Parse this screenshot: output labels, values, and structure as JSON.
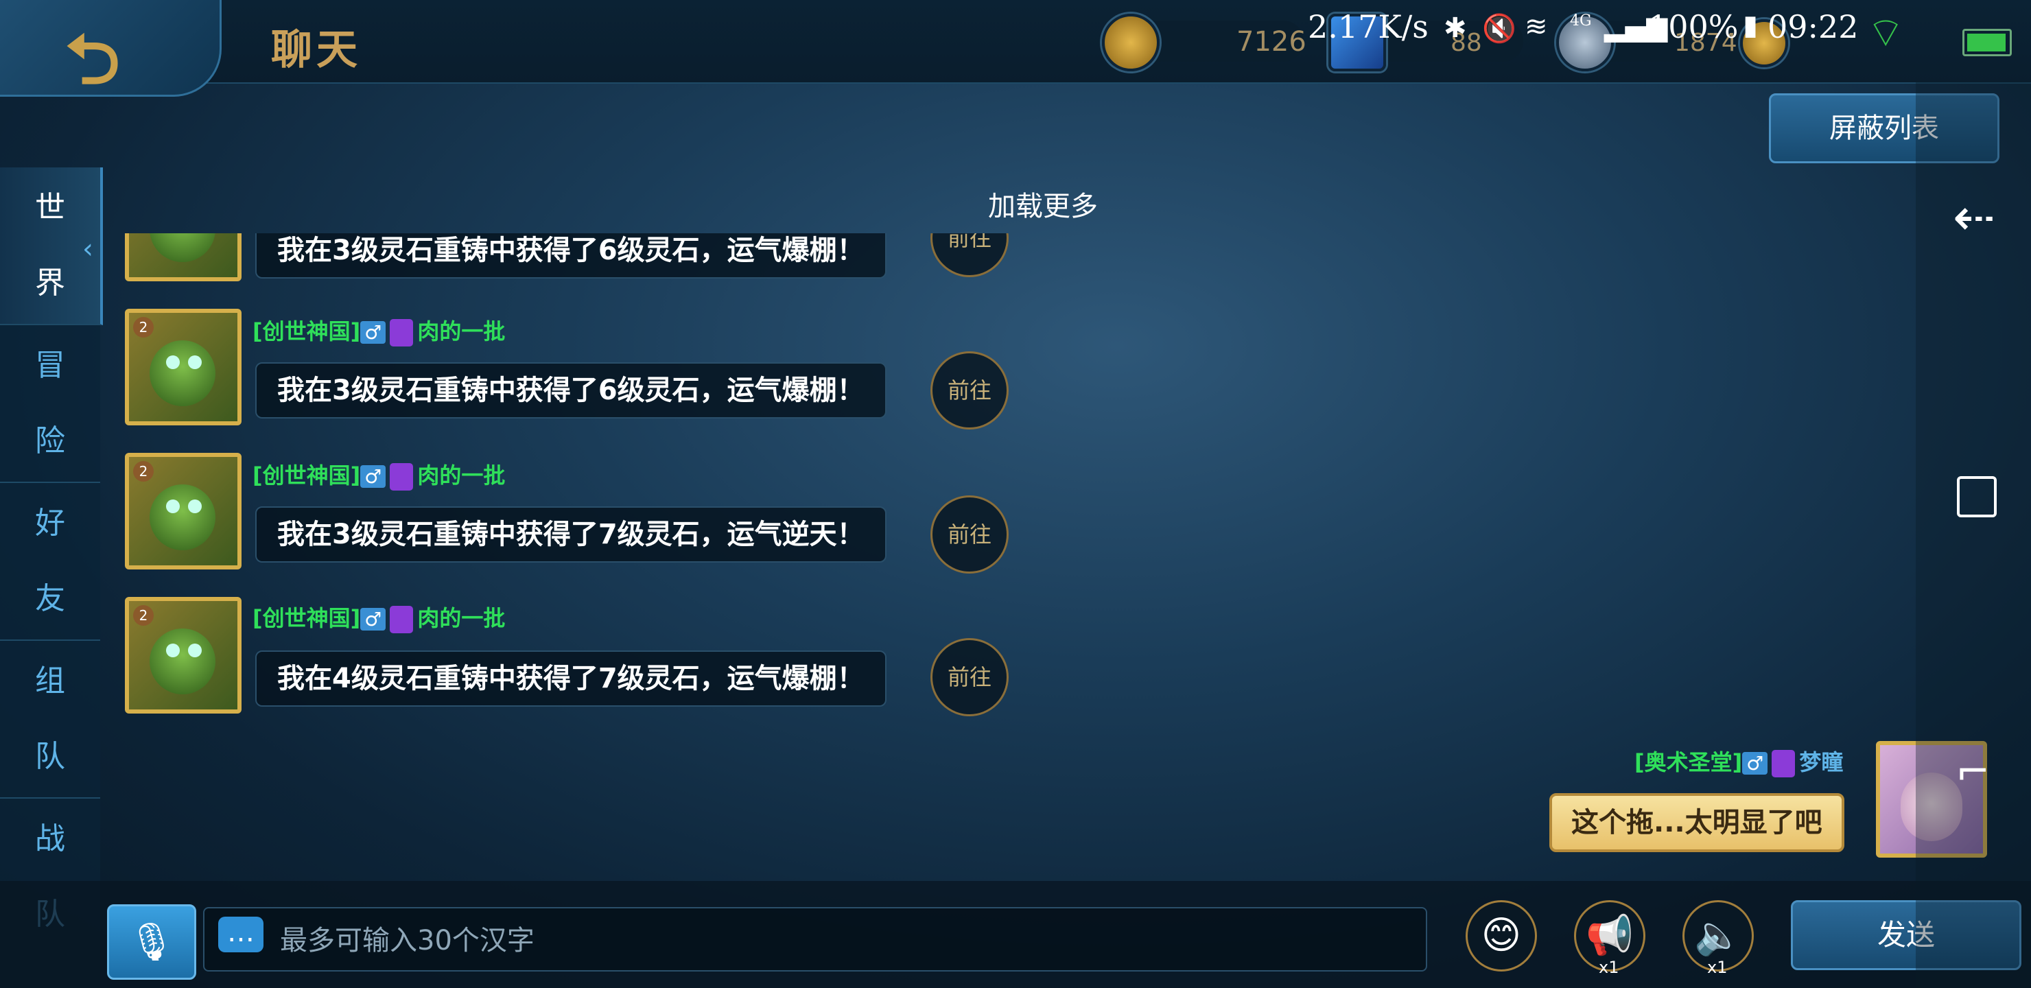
{
  "header": {
    "title": "聊天",
    "back_icon": "back-arrow-icon"
  },
  "resources": [
    {
      "name": "gold-coin-icon",
      "value": "7126",
      "color": "#c89a2e"
    },
    {
      "name": "diamond-icon",
      "value": "88",
      "color": "#2e6fd6"
    },
    {
      "name": "crystal-icon",
      "value": "1874",
      "color": "#8aa0b8"
    }
  ],
  "status_bar": {
    "net_speed": "2.17K/s",
    "battery": "100%",
    "time": "09:22",
    "signal": "4G"
  },
  "block_list_label": "屏蔽列表",
  "tabs": [
    {
      "label_1": "世",
      "label_2": "界"
    },
    {
      "label_1": "冒",
      "label_2": "险"
    },
    {
      "label_1": "好",
      "label_2": "友"
    },
    {
      "label_1": "组",
      "label_2": "队"
    },
    {
      "label_1": "战",
      "label_2": "队"
    }
  ],
  "load_more": "加载更多",
  "messages": [
    {
      "text": "我在3级灵石重铸中获得了6级灵石，运气爆棚！",
      "go": "前往"
    },
    {
      "guild": "[创世神国]",
      "gender": "♂",
      "name": "肉的一批",
      "text": "我在3级灵石重铸中获得了6级灵石，运气爆棚！",
      "go": "前往"
    },
    {
      "guild": "[创世神国]",
      "gender": "♂",
      "name": "肉的一批",
      "text": "我在3级灵石重铸中获得了7级灵石，运气逆天！",
      "go": "前往"
    },
    {
      "guild": "[创世神国]",
      "gender": "♂",
      "name": "肉的一批",
      "text": "我在4级灵石重铸中获得了7级灵石，运气爆棚！",
      "go": "前往"
    }
  ],
  "self_message": {
    "guild": "[奥术圣堂]",
    "gender": "♂",
    "name": "梦瞳",
    "text": "这个拖...太明显了吧"
  },
  "input": {
    "placeholder": "最多可输入30个汉字"
  },
  "bottom_buttons": {
    "emoji": "😊",
    "horn_count": "x1",
    "speaker_count": "x1",
    "send_label": "发送"
  }
}
